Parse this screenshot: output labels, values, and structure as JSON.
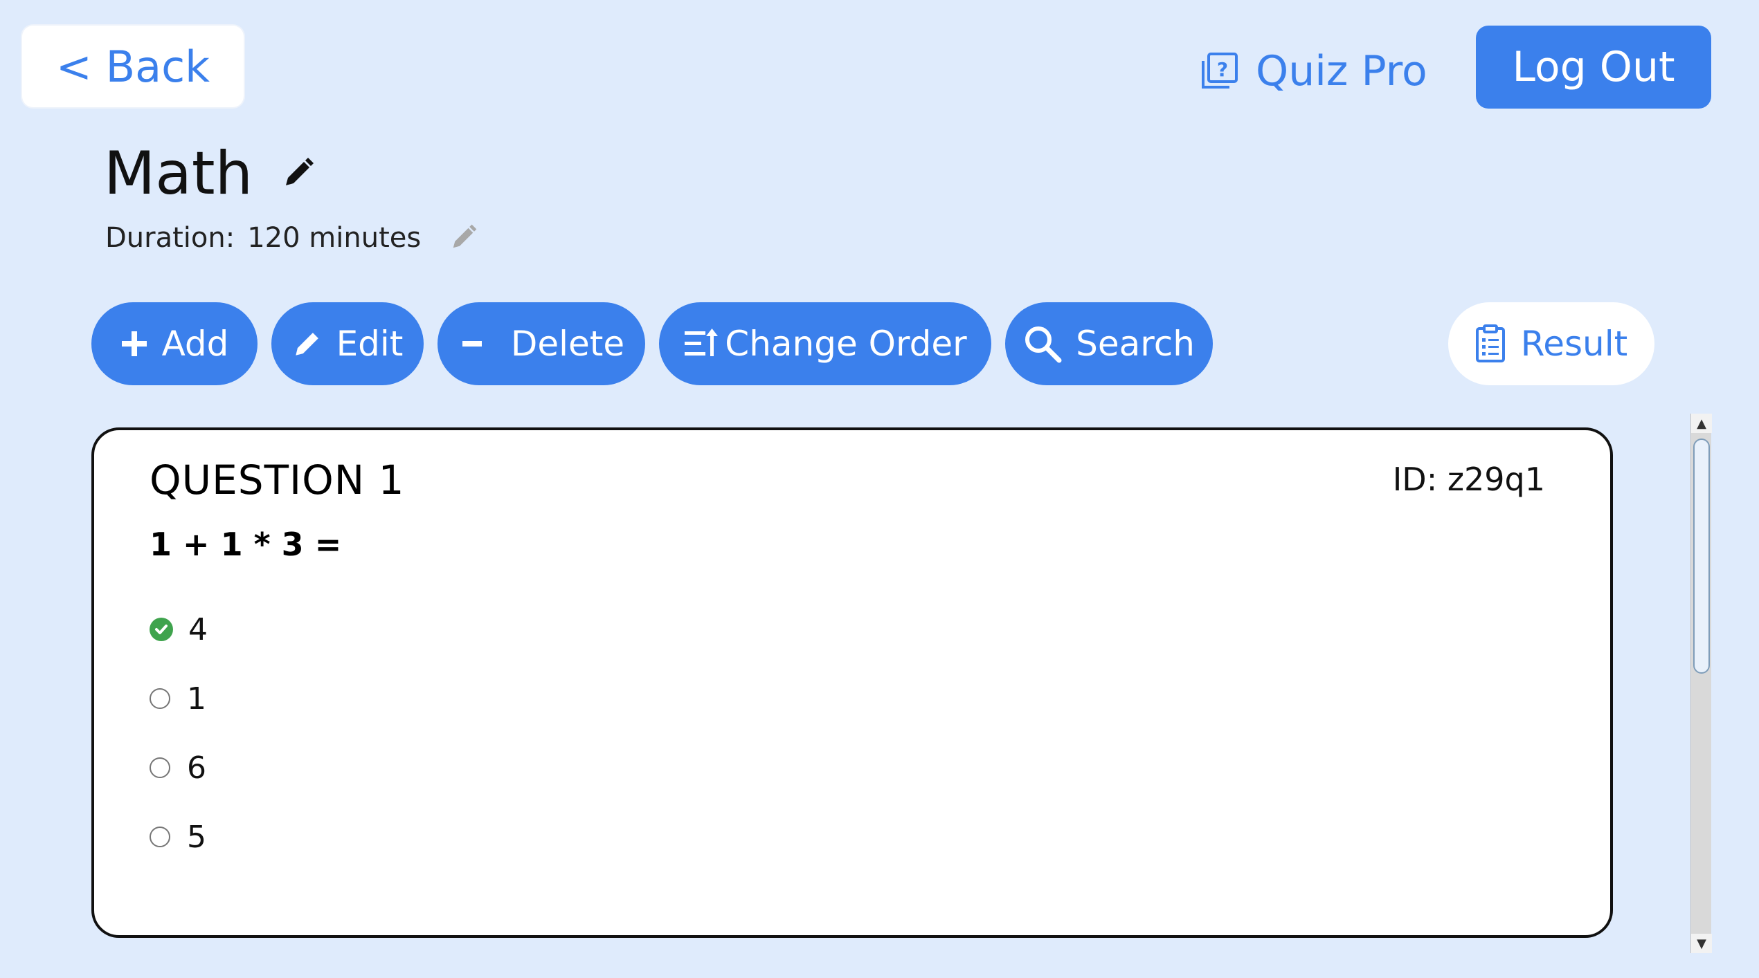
{
  "header": {
    "back_label": "< Back",
    "brand_name": "Quiz Pro",
    "logout_label": "Log Out"
  },
  "quiz": {
    "title": "Math",
    "duration_label": "Duration:",
    "duration_value": "120 minutes"
  },
  "toolbar": {
    "add_label": "Add",
    "edit_label": "Edit",
    "delete_label": "Delete",
    "change_order_label": "Change Order",
    "search_label": "Search",
    "result_label": "Result"
  },
  "question": {
    "title": "QUESTION 1",
    "id_label": "ID: z29q1",
    "text": "1 + 1 * 3 =",
    "options": [
      {
        "label": "4",
        "correct": true
      },
      {
        "label": "1",
        "correct": false
      },
      {
        "label": "6",
        "correct": false
      },
      {
        "label": "5",
        "correct": false
      }
    ]
  },
  "colors": {
    "background": "#dfebfc",
    "accent": "#3b80ec",
    "correct": "#3fa34d"
  }
}
